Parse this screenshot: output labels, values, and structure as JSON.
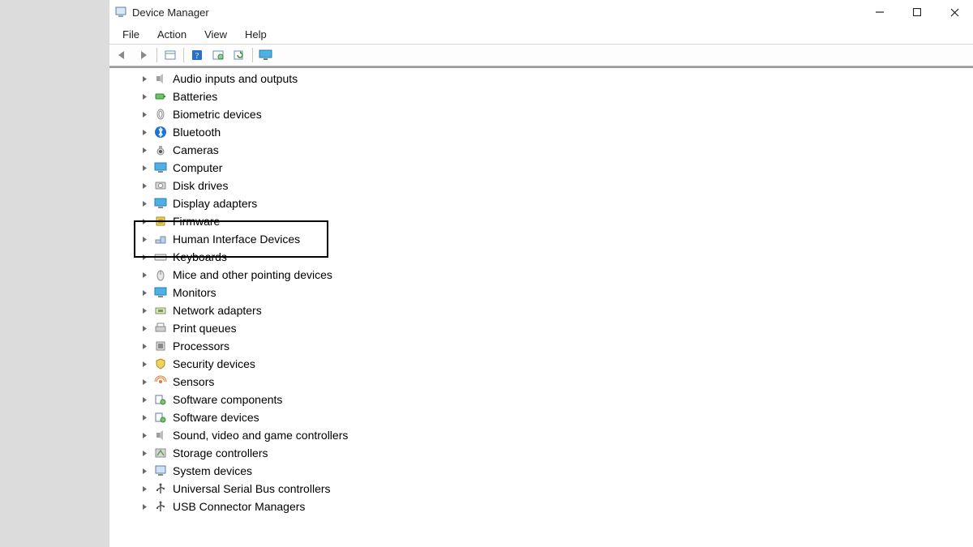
{
  "window": {
    "title": "Device Manager"
  },
  "menu": {
    "file": "File",
    "action": "Action",
    "view": "View",
    "help": "Help"
  },
  "categories": [
    {
      "id": "audio",
      "label": "Audio inputs and outputs",
      "icon": "speaker"
    },
    {
      "id": "batteries",
      "label": "Batteries",
      "icon": "battery"
    },
    {
      "id": "biometric",
      "label": "Biometric devices",
      "icon": "finger"
    },
    {
      "id": "bluetooth",
      "label": "Bluetooth",
      "icon": "bt"
    },
    {
      "id": "cameras",
      "label": "Cameras",
      "icon": "camera"
    },
    {
      "id": "computer",
      "label": "Computer",
      "icon": "monitor"
    },
    {
      "id": "disks",
      "label": "Disk drives",
      "icon": "disk"
    },
    {
      "id": "display",
      "label": "Display adapters",
      "icon": "monitor"
    },
    {
      "id": "firmware",
      "label": "Firmware",
      "icon": "chip"
    },
    {
      "id": "hid",
      "label": "Human Interface Devices",
      "icon": "hid"
    },
    {
      "id": "keyboards",
      "label": "Keyboards",
      "icon": "keyboard"
    },
    {
      "id": "mice",
      "label": "Mice and other pointing devices",
      "icon": "mouse"
    },
    {
      "id": "monitors",
      "label": "Monitors",
      "icon": "monitor"
    },
    {
      "id": "network",
      "label": "Network adapters",
      "icon": "net"
    },
    {
      "id": "print",
      "label": "Print queues",
      "icon": "printer"
    },
    {
      "id": "cpu",
      "label": "Processors",
      "icon": "cpu"
    },
    {
      "id": "security",
      "label": "Security devices",
      "icon": "shield"
    },
    {
      "id": "sensors",
      "label": "Sensors",
      "icon": "sensor"
    },
    {
      "id": "swcomp",
      "label": "Software components",
      "icon": "sw"
    },
    {
      "id": "swdev",
      "label": "Software devices",
      "icon": "sw"
    },
    {
      "id": "sound",
      "label": "Sound, video and game controllers",
      "icon": "speaker"
    },
    {
      "id": "storage",
      "label": "Storage controllers",
      "icon": "storage"
    },
    {
      "id": "system",
      "label": "System devices",
      "icon": "system"
    },
    {
      "id": "usb",
      "label": "Universal Serial Bus controllers",
      "icon": "usb"
    },
    {
      "id": "usbconn",
      "label": "USB Connector Managers",
      "icon": "usb"
    }
  ],
  "highlight_id": "hid"
}
